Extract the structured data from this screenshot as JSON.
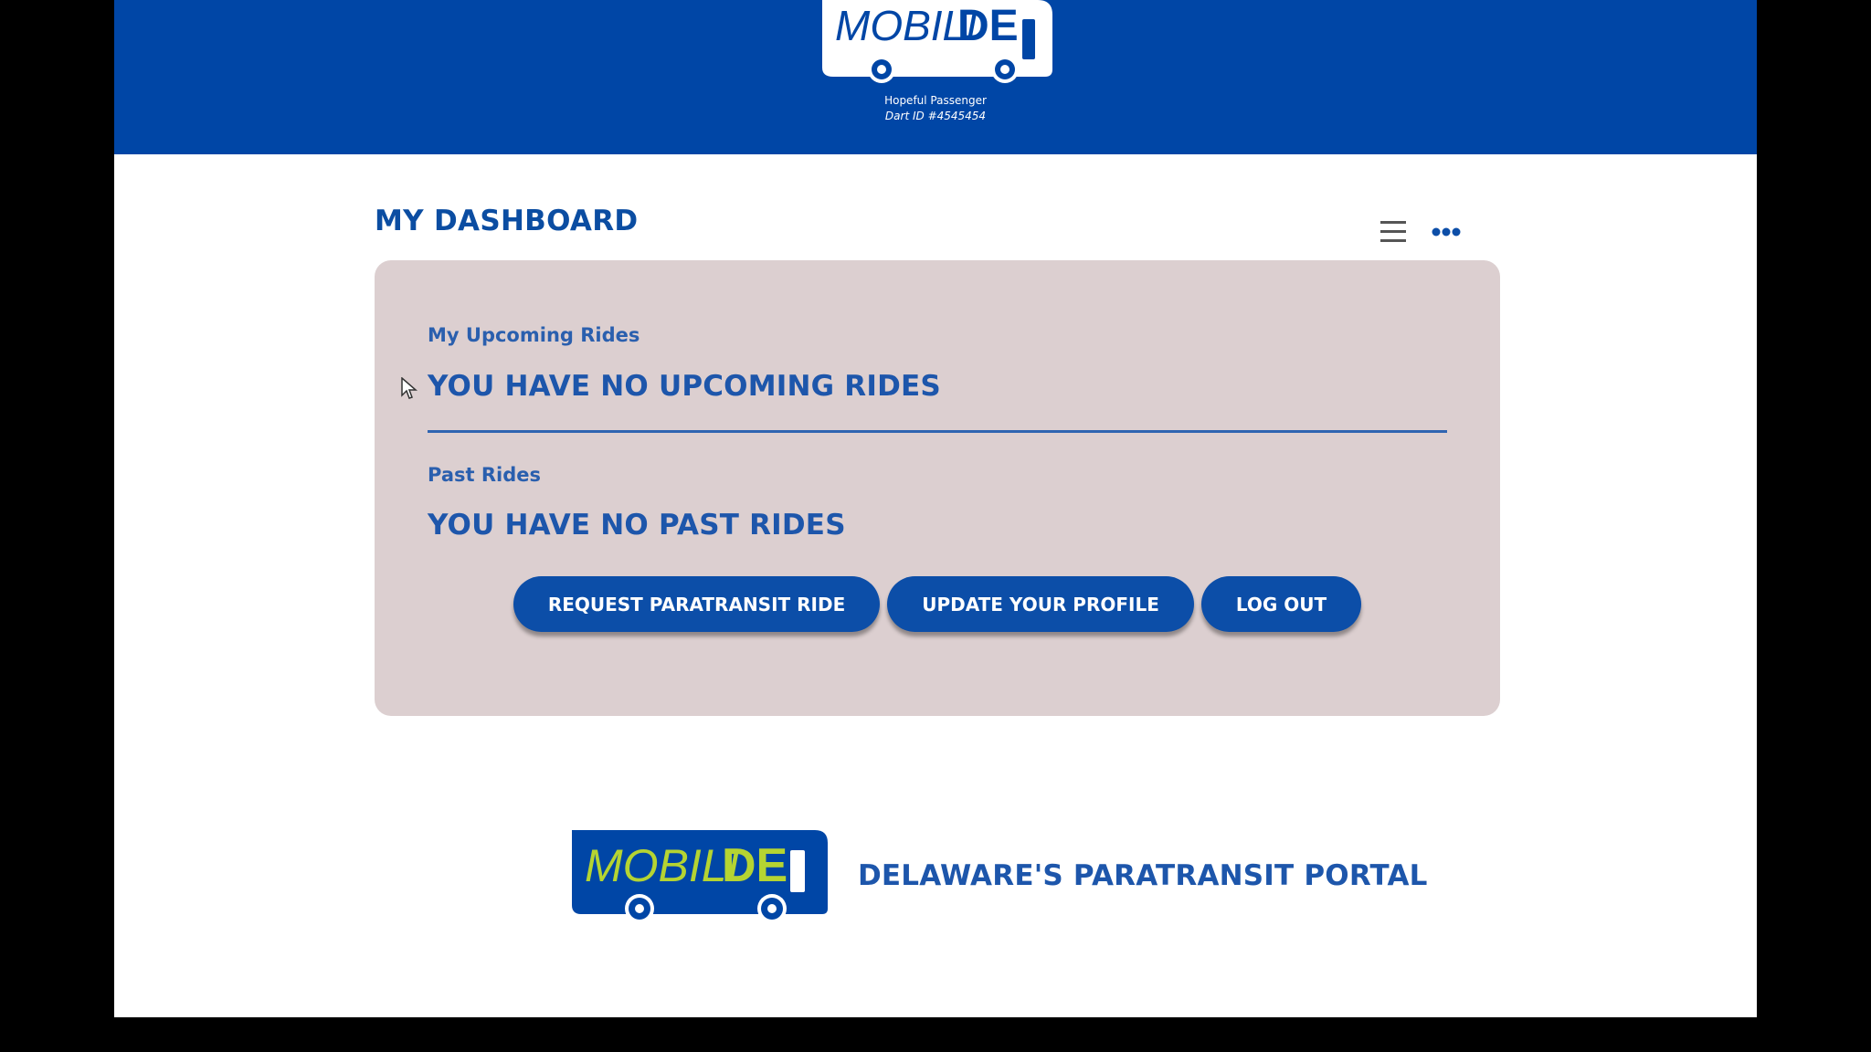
{
  "header": {
    "logo": {
      "text_left": "MOBILI",
      "text_right": "DE"
    },
    "passenger_name": "Hopeful Passenger",
    "dart_id": "Dart ID #4545454"
  },
  "dashboard": {
    "title": "MY DASHBOARD",
    "toolbar": {
      "icons": [
        "menu-icon",
        "more-options-icon"
      ]
    }
  },
  "upcoming": {
    "label": "My Upcoming Rides",
    "status": "YOU HAVE NO UPCOMING RIDES"
  },
  "past": {
    "label": "Past Rides",
    "status": "YOU HAVE NO PAST RIDES"
  },
  "actions": {
    "request_label": "REQUEST PARATRANSIT RIDE",
    "profile_label": "UPDATE YOUR PROFILE",
    "logout_label": "LOG OUT"
  },
  "footer": {
    "logo": {
      "text_left": "MOBILI",
      "text_right": "DE"
    },
    "tagline": "DELAWARE'S PARATRANSIT PORTAL"
  },
  "colors": {
    "brand_blue": "#0046a6",
    "button_blue": "#0c4ea8",
    "card_background": "#dccfd0",
    "logo_green": "#b5d432",
    "backdrop": "#000000"
  }
}
